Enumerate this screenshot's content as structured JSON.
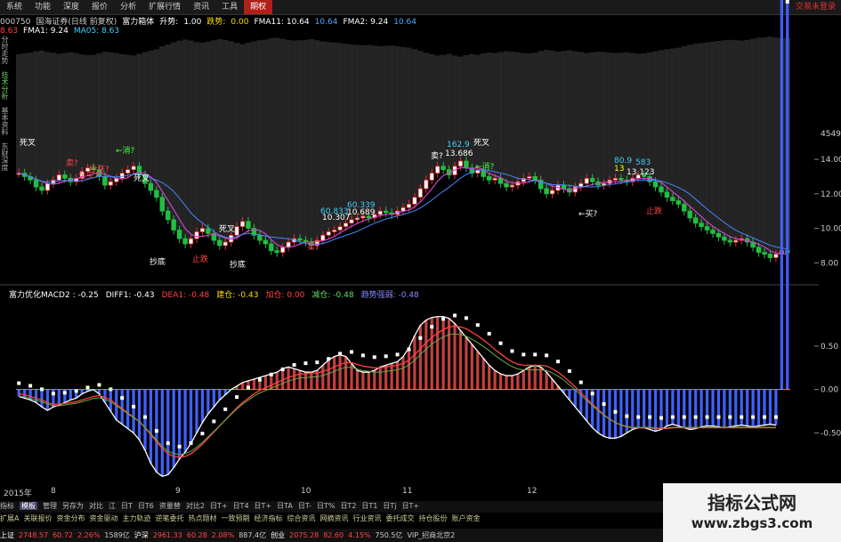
{
  "menu": {
    "items": [
      "系统",
      "功能",
      "深度",
      "报价",
      "分析",
      "扩展行情",
      "资讯",
      "工具",
      "期权"
    ],
    "active_index": 8,
    "brand": "交易未登录"
  },
  "info": {
    "code": "000750",
    "name": "国海证券(日线 前复权)",
    "indicator": "富力箱体",
    "rise_label": "升势:",
    "rise_val": "1.00",
    "trend_label": "跌势:",
    "trend_val": "0.00",
    "fma11": "FMA11: 10.64",
    "val2": "10.64",
    "fma2": "FMA2: 9.24",
    "val3": "10.64",
    "row2_v1": "8.63",
    "row2_fma1": "FMA1: 9.24",
    "row2_ma05": "MA05: 8.63"
  },
  "sidebar": [
    "分时走势",
    "技术分析",
    "基本资料",
    "东财深度"
  ],
  "macd_info": {
    "name": "富力优化MACD2 : -0.25",
    "diff": "DIFF1: -0.43",
    "dea": "DEA1: -0.48",
    "jiancang": "建仓: -0.43",
    "jiacang": "加仓: 0.00",
    "jiancang2": "减仓: -0.48",
    "strength": "趋势强弱: -0.48"
  },
  "price_axis": {
    "top_label": "4549",
    "ticks": [
      "14.00",
      "12.00",
      "10.00",
      "8.00"
    ]
  },
  "macd_axis": {
    "ticks": [
      "0.50",
      "0.00",
      "-0.50"
    ]
  },
  "x_axis": {
    "labels": [
      "2015年",
      "8",
      "9",
      "10",
      "11",
      "12",
      "1"
    ]
  },
  "annotations": {
    "sicha1": "死叉",
    "sicha2": "死叉",
    "sicha3": "死叉",
    "sicha4": "死叉",
    "buy1": "←消?",
    "buy2": "←消?",
    "sell1": "卖?",
    "sell2": "卖?",
    "sell3": "卖?",
    "quanmai": "全买?",
    "chaodi1": "抄底",
    "chaodi2": "抄底",
    "zhidie1": "止跌",
    "zhidie2": "止跌",
    "buy3": "←买?",
    "v1": "60.833",
    "v2": "10.307",
    "v3": "60.339",
    "v4": "10.689",
    "v5": "162.9",
    "v6": "13.686",
    "v7": "80.9",
    "v8": "13",
    "v9": "13.123",
    "v10": "583",
    "chaopo": "抄涨?"
  },
  "bottom_tabs": [
    "指标",
    "模板",
    "管理",
    "另存为",
    "对比",
    "江",
    "日T",
    "日T6",
    "资量替",
    "对比2",
    "日T+",
    "日T4",
    "日T+",
    "日TA",
    "日T-",
    "日T%",
    "日T2",
    "日T1",
    "日Tj",
    "日T+"
  ],
  "bottom_tabs_selected": 1,
  "func_bar": [
    "扩展A",
    "关联报价",
    "资金分布",
    "资金驱动",
    "主力轨迹",
    "逆笔委托",
    "热点题材",
    "一致预期",
    "经济指标",
    "综合资讯",
    "网摘资讯",
    "行业资讯",
    "委托成交",
    "持仓股份",
    "账户资金"
  ],
  "status": {
    "sh_label": "上证",
    "sh_val": "2748.57",
    "sh_chg": "60.72",
    "sh_pct": "2.26%",
    "sh_amt": "1589亿",
    "hs_label": "沪深",
    "hs_val": "2961.33",
    "hs_chg": "60.28",
    "hs_pct": "2.08%",
    "hs_amt": "887.4亿",
    "cy_label": "创业",
    "cy_val": "2075.28",
    "cy_chg": "82.60",
    "cy_pct": "4.15%",
    "cy_amt": "750.5亿",
    "vip": "VIP_招商北京2"
  },
  "watermark": {
    "title": "指标公式网",
    "url": "www.zbgs3.com"
  },
  "colors": {
    "up": "#e03030",
    "down": "#20c040",
    "diff": "#ffffff",
    "dea": "#ff4040",
    "dea2": "#40c0c0",
    "zero": "#ff8040",
    "hist_pos": "#c04040",
    "hist_neg": "#4060ff"
  },
  "chart_data": {
    "type": "candlestick+macd",
    "x_labels": [
      "2015年",
      "8",
      "9",
      "10",
      "11",
      "12",
      "1"
    ],
    "price_ylim": [
      7.5,
      15.5
    ],
    "price_ticks": [
      14,
      12,
      10,
      8
    ],
    "closes": [
      13.2,
      13.0,
      12.8,
      12.4,
      12.2,
      12.6,
      12.8,
      13.1,
      12.9,
      12.7,
      12.9,
      13.3,
      13.5,
      13.4,
      13.0,
      12.5,
      12.7,
      12.9,
      13.2,
      13.4,
      13.6,
      13.1,
      12.6,
      12.2,
      11.8,
      11.0,
      10.5,
      9.9,
      9.4,
      9.1,
      9.4,
      9.8,
      10.0,
      9.7,
      9.3,
      9.0,
      9.2,
      9.6,
      10.1,
      10.4,
      10.0,
      9.6,
      9.3,
      9.1,
      8.7,
      8.6,
      8.9,
      9.2,
      9.4,
      9.3,
      9.2,
      9.0,
      9.3,
      9.6,
      9.8,
      9.9,
      10.1,
      10.3,
      10.5,
      10.6,
      10.7,
      10.6,
      10.8,
      11.0,
      10.9,
      10.8,
      11.0,
      11.2,
      11.4,
      11.8,
      12.3,
      12.8,
      13.2,
      13.6,
      13.4,
      13.1,
      13.6,
      13.9,
      13.5,
      13.2,
      13.4,
      13.0,
      12.8,
      12.9,
      12.6,
      12.4,
      12.5,
      12.7,
      12.9,
      13.0,
      12.8,
      12.3,
      12.0,
      12.2,
      12.5,
      12.3,
      12.1,
      12.4,
      12.6,
      12.9,
      12.7,
      12.5,
      12.6,
      12.8,
      12.9,
      12.8,
      12.7,
      12.9,
      13.1,
      13.0,
      12.7,
      12.4,
      12.1,
      11.8,
      11.6,
      11.4,
      11.0,
      10.6,
      10.3,
      10.1,
      9.9,
      9.7,
      9.5,
      9.3,
      9.2,
      9.3,
      9.4,
      9.2,
      8.9,
      8.6,
      8.5,
      8.3,
      8.5,
      8.7,
      8.6
    ],
    "diff": [
      -0.08,
      -0.1,
      -0.12,
      -0.15,
      -0.2,
      -0.24,
      -0.2,
      -0.18,
      -0.15,
      -0.12,
      -0.1,
      -0.05,
      -0.02,
      0.0,
      -0.05,
      -0.15,
      -0.25,
      -0.35,
      -0.4,
      -0.45,
      -0.5,
      -0.58,
      -0.7,
      -0.85,
      -0.95,
      -1.0,
      -0.98,
      -0.9,
      -0.8,
      -0.72,
      -0.62,
      -0.5,
      -0.38,
      -0.28,
      -0.2,
      -0.12,
      -0.06,
      0.0,
      0.04,
      0.08,
      0.1,
      0.12,
      0.14,
      0.16,
      0.18,
      0.2,
      0.24,
      0.26,
      0.24,
      0.22,
      0.2,
      0.2,
      0.22,
      0.28,
      0.34,
      0.38,
      0.4,
      0.38,
      0.3,
      0.22,
      0.2,
      0.2,
      0.22,
      0.26,
      0.28,
      0.3,
      0.32,
      0.38,
      0.48,
      0.62,
      0.74,
      0.8,
      0.83,
      0.84,
      0.84,
      0.82,
      0.76,
      0.68,
      0.6,
      0.52,
      0.44,
      0.36,
      0.28,
      0.22,
      0.18,
      0.16,
      0.16,
      0.18,
      0.22,
      0.26,
      0.28,
      0.26,
      0.2,
      0.12,
      0.04,
      -0.04,
      -0.12,
      -0.2,
      -0.28,
      -0.36,
      -0.44,
      -0.5,
      -0.54,
      -0.56,
      -0.56,
      -0.54,
      -0.5,
      -0.46,
      -0.44,
      -0.44,
      -0.46,
      -0.48,
      -0.46,
      -0.42,
      -0.4,
      -0.42,
      -0.44,
      -0.46,
      -0.45,
      -0.43,
      -0.42,
      -0.42,
      -0.43,
      -0.44,
      -0.43,
      -0.42,
      -0.41,
      -0.42,
      -0.43,
      -0.42,
      -0.41,
      -0.4,
      -0.41
    ],
    "dea": [
      -0.05,
      -0.06,
      -0.08,
      -0.1,
      -0.12,
      -0.15,
      -0.17,
      -0.17,
      -0.16,
      -0.15,
      -0.14,
      -0.12,
      -0.1,
      -0.08,
      -0.07,
      -0.09,
      -0.12,
      -0.17,
      -0.22,
      -0.27,
      -0.32,
      -0.37,
      -0.44,
      -0.52,
      -0.6,
      -0.68,
      -0.74,
      -0.77,
      -0.78,
      -0.77,
      -0.74,
      -0.69,
      -0.63,
      -0.56,
      -0.49,
      -0.42,
      -0.35,
      -0.28,
      -0.21,
      -0.15,
      -0.1,
      -0.05,
      -0.01,
      0.02,
      0.05,
      0.08,
      0.11,
      0.14,
      0.16,
      0.18,
      0.18,
      0.19,
      0.19,
      0.21,
      0.23,
      0.26,
      0.29,
      0.31,
      0.31,
      0.29,
      0.27,
      0.26,
      0.25,
      0.25,
      0.26,
      0.27,
      0.28,
      0.3,
      0.34,
      0.4,
      0.47,
      0.54,
      0.6,
      0.65,
      0.69,
      0.72,
      0.73,
      0.72,
      0.7,
      0.66,
      0.62,
      0.57,
      0.52,
      0.46,
      0.41,
      0.36,
      0.32,
      0.29,
      0.28,
      0.28,
      0.28,
      0.28,
      0.27,
      0.24,
      0.2,
      0.15,
      0.09,
      0.03,
      -0.04,
      -0.1,
      -0.17,
      -0.23,
      -0.29,
      -0.34,
      -0.38,
      -0.41,
      -0.43,
      -0.44,
      -0.44,
      -0.44,
      -0.44,
      -0.45,
      -0.45,
      -0.45,
      -0.44,
      -0.44,
      -0.44,
      -0.44,
      -0.44,
      -0.44,
      -0.44,
      -0.44,
      -0.44,
      -0.44,
      -0.44,
      -0.44,
      -0.44,
      -0.44,
      -0.44,
      -0.44,
      -0.44,
      -0.44,
      -0.44
    ],
    "macd_ylim": [
      -1.1,
      0.95
    ],
    "macd_ticks": [
      0.5,
      0.0,
      -0.5
    ]
  }
}
